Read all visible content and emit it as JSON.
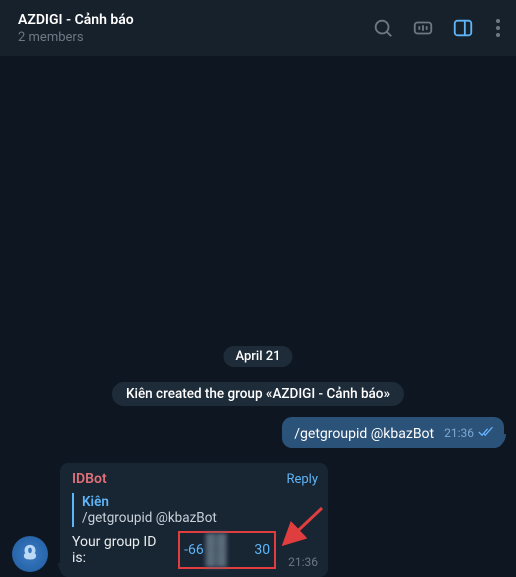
{
  "header": {
    "title": "AZDIGI - Cảnh báo",
    "subtitle": "2 members"
  },
  "divider": {
    "date": "April 21"
  },
  "service": {
    "text": "Kiên created the group «AZDIGI - Cảnh báo»"
  },
  "out": {
    "text": "/getgroupid @kbazBot",
    "time": "21:36"
  },
  "in": {
    "sender": "IDBot",
    "reply_label": "Reply",
    "reply": {
      "sender": "Kiên",
      "text": "/getgroupid @kbazBot"
    },
    "body_prefix": "Your group ID is:",
    "gid_prefix": "-66",
    "gid_suffix": "30",
    "time": "21:36"
  }
}
